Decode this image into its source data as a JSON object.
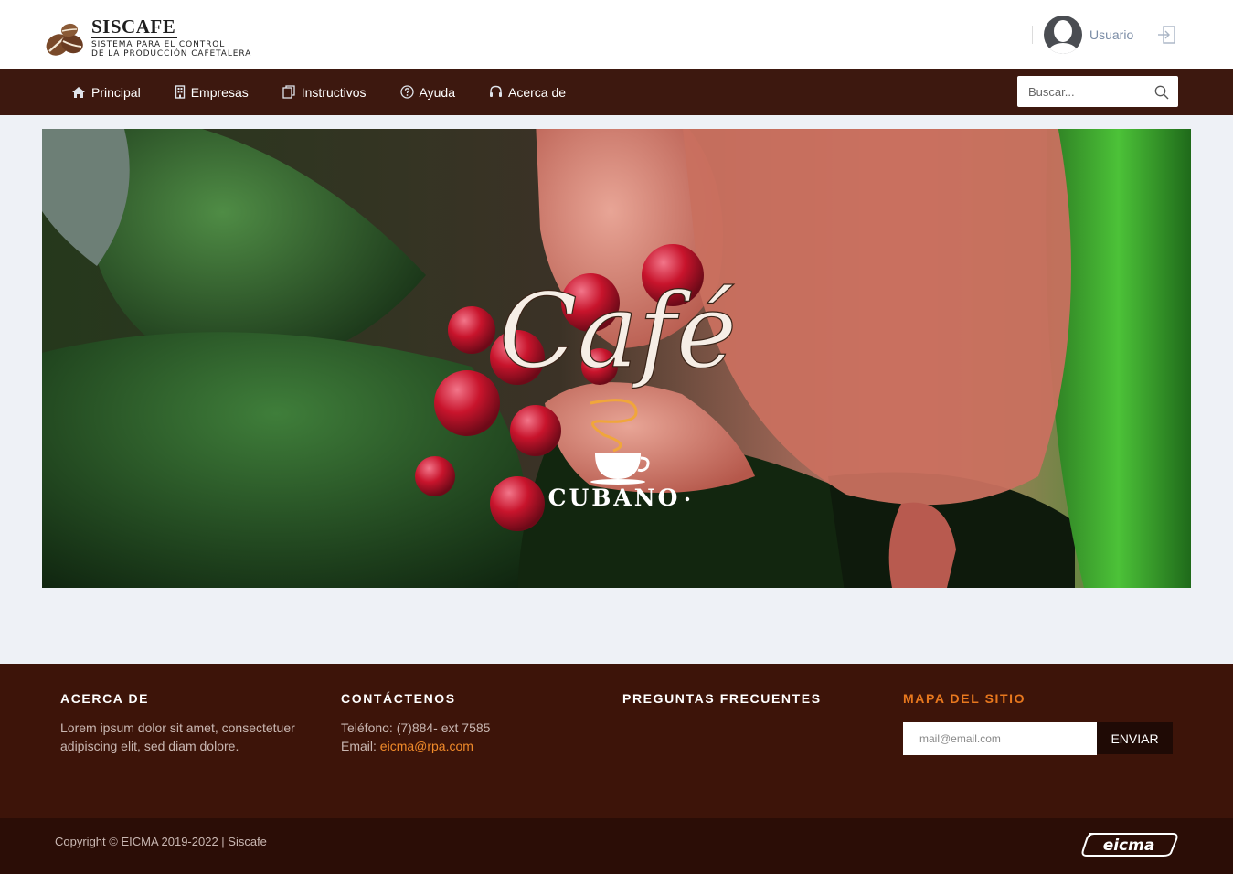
{
  "brand": {
    "title": "SISCAFE",
    "subtitle_line1": "SISTEMA PARA EL CONTROL",
    "subtitle_line2": "DE LA PRODUCCIÓN CAFETALERA"
  },
  "user": {
    "name": "Usuario"
  },
  "nav": {
    "items": [
      {
        "label": "Principal",
        "icon": "home-icon"
      },
      {
        "label": "Empresas",
        "icon": "building-icon"
      },
      {
        "label": "Instructivos",
        "icon": "documents-icon"
      },
      {
        "label": "Ayuda",
        "icon": "question-icon"
      },
      {
        "label": "Acerca de",
        "icon": "headset-icon"
      }
    ],
    "search_placeholder": "Buscar..."
  },
  "hero": {
    "script_text": "Café",
    "brand_text": "CUBANO"
  },
  "footer": {
    "about": {
      "heading": "ACERCA DE",
      "text": "Lorem ipsum dolor sit amet, consectetuer adipiscing elit, sed diam dolore."
    },
    "contact": {
      "heading": "CONTÁCTENOS",
      "phone": "Teléfono: (7)884- ext 7585",
      "email_label": "Email: ",
      "email": "eicma@rpa.com"
    },
    "faq": {
      "heading": "PREGUNTAS FRECUENTES"
    },
    "sitemap": {
      "heading": "MAPA DEL SITIO",
      "email_placeholder": "mail@email.com",
      "button": "ENVIAR"
    },
    "copyright": "Copyright © EICMA 2019-2022 | Siscafe",
    "partner_logo": "eicma"
  },
  "colors": {
    "nav_bg": "#3d180f",
    "footer_bg": "#3d1409",
    "footer_bottom": "#2b0d06",
    "accent": "#e8781e",
    "link": "#f08a2a",
    "user_text": "#7a8ca6"
  }
}
